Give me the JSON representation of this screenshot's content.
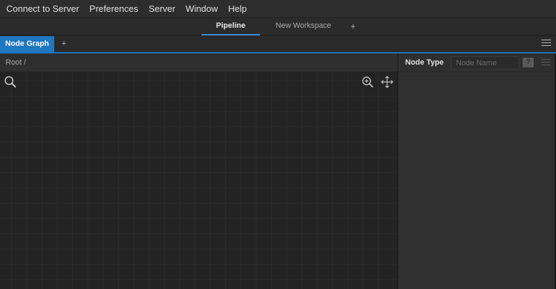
{
  "menubar": {
    "items": [
      "Connect to Server",
      "Preferences",
      "Server",
      "Window",
      "Help"
    ]
  },
  "workspace_tabs": {
    "tabs": [
      {
        "label": "Pipeline",
        "active": true
      },
      {
        "label": "New Workspace",
        "active": false
      }
    ],
    "add_label": "+"
  },
  "panel_tabs": {
    "active_label": "Node Graph",
    "add_label": "+",
    "menu_icon": "hamburger-menu-icon"
  },
  "node_graph": {
    "breadcrumb": "Root /",
    "search_icon": "search-icon",
    "zoom_icon": "zoom-in-icon",
    "pan_icon": "move-arrows-icon"
  },
  "node_type_panel": {
    "title": "Node Type",
    "search_value": "",
    "search_placeholder": "Node Name",
    "help_label": "?",
    "menu_icon": "hamburger-menu-icon"
  },
  "colors": {
    "accent": "#1f76c1",
    "tab_underline": "#3d8fd9",
    "background": "#2b2b2b",
    "canvas": "#232323"
  }
}
